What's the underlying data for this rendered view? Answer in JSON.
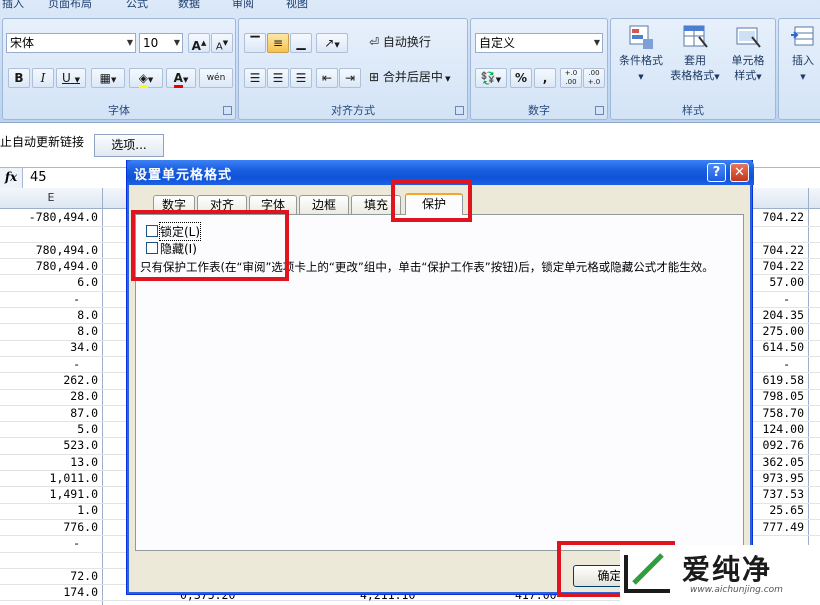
{
  "ribbon": {
    "tabs": [
      "插入",
      "页面布局",
      "公式",
      "数据",
      "审阅",
      "视图"
    ],
    "font_group": {
      "label": "字体",
      "font_name": "宋体",
      "font_size": "10",
      "grow_font": "A",
      "shrink_font": "A",
      "bold": "B",
      "italic": "I",
      "underline": "U",
      "font_color": "A",
      "phonetic": "wén"
    },
    "align_group": {
      "label": "对齐方式",
      "wrap_text": "自动换行",
      "merge_center": "合并后居中"
    },
    "number_group": {
      "label": "数字",
      "format": "自定义",
      "percent": "%",
      "comma": ",",
      "inc_decimal": "+.0 .00",
      "dec_decimal": ".00 +.0"
    },
    "styles_group": {
      "label": "样式",
      "conditional": "条件格式",
      "table_format_1": "套用",
      "table_format_2": "表格格式",
      "cell_styles_1": "单元格",
      "cell_styles_2": "样式"
    },
    "cells_group": {
      "insert": "插入"
    }
  },
  "security_bar": {
    "message": "止自动更新链接",
    "options_button": "选项..."
  },
  "formula_bar": {
    "fx": "fx",
    "value": "45"
  },
  "sheet": {
    "column_e": "E",
    "left_values": [
      "-780,494.0",
      "",
      "780,494.0",
      "780,494.0",
      "6.0",
      "-",
      "8.0",
      "8.0",
      "34.0",
      "-",
      "262.0",
      "28.0",
      "87.0",
      "5.0",
      "523.0",
      "13.0",
      "1,011.0",
      "1,491.0",
      "1.0",
      "776.0",
      "-",
      "",
      "72.0",
      "174.0"
    ],
    "right_values": [
      "704.22",
      "",
      "704.22",
      "704.22",
      "57.00",
      "-",
      "204.35",
      "275.00",
      "614.50",
      "-",
      "619.58",
      "798.05",
      "758.70",
      "124.00",
      "092.76",
      "362.05",
      "973.95",
      "737.53",
      "25.65",
      "777.49",
      "",
      "",
      "",
      ""
    ],
    "bottom_partial": [
      "0,375.20",
      "4,211.10",
      "417.00"
    ]
  },
  "dialog": {
    "title": "设置单元格格式",
    "help": "?",
    "close": "✕",
    "tabs": [
      "数字",
      "对齐",
      "字体",
      "边框",
      "填充",
      "保护"
    ],
    "selected_tab": "保护",
    "locked_label": "锁定(L)",
    "hidden_label": "隐藏(I)",
    "locked_checked": false,
    "hidden_checked": false,
    "note": "只有保护工作表(在“审阅”选项卡上的“更改”组中，单击“保护工作表”按钮)后，锁定单元格或隐藏公式才能生效。",
    "ok_button": "确定"
  },
  "watermark": {
    "name": "爱纯净",
    "url": "www.aichunjing.com"
  },
  "colors": {
    "highlight": "#e0141e",
    "title_bar": "#0f52d8",
    "ribbon": "#c6daf2"
  }
}
